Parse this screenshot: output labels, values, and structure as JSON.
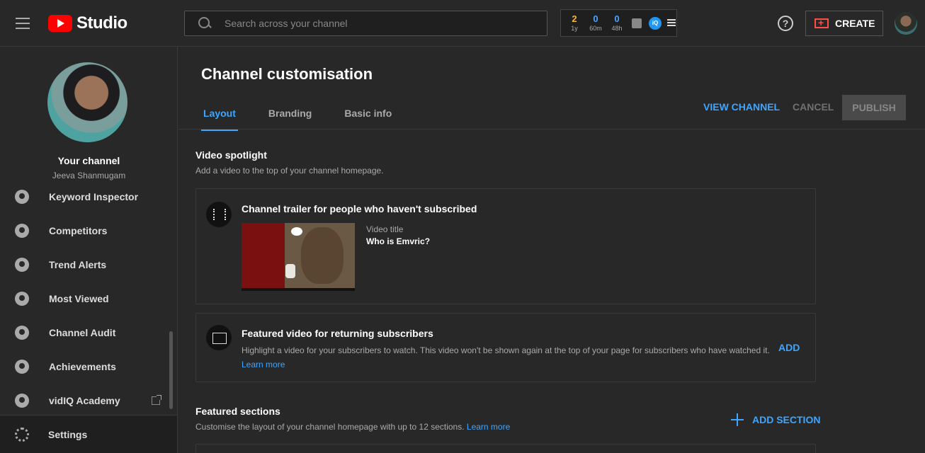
{
  "header": {
    "logo_text": "Studio",
    "search_placeholder": "Search across your channel",
    "vidiq_stats": [
      {
        "value": "2",
        "label": "1y",
        "color": "#f6b93b"
      },
      {
        "value": "0",
        "label": "60m",
        "color": "#4fa3ff"
      },
      {
        "value": "0",
        "label": "48h",
        "color": "#4fa3ff"
      }
    ],
    "vidiq_logo": "iQ",
    "help_label": "?",
    "create_label": "CREATE"
  },
  "sidebar": {
    "your_channel": "Your channel",
    "channel_name": "Jeeva Shanmugam",
    "items": [
      {
        "label": "Keyword Inspector"
      },
      {
        "label": "Competitors"
      },
      {
        "label": "Trend Alerts"
      },
      {
        "label": "Most Viewed"
      },
      {
        "label": "Channel Audit"
      },
      {
        "label": "Achievements"
      },
      {
        "label": "vidIQ Academy"
      }
    ],
    "settings_label": "Settings"
  },
  "main": {
    "title": "Channel customisation",
    "tabs": [
      {
        "label": "Layout"
      },
      {
        "label": "Branding"
      },
      {
        "label": "Basic info"
      }
    ],
    "view_channel": "VIEW CHANNEL",
    "cancel": "CANCEL",
    "publish": "PUBLISH",
    "video_spotlight": {
      "title": "Video spotlight",
      "subtitle": "Add a video to the top of your channel homepage."
    },
    "trailer_card": {
      "title": "Channel trailer for people who haven't subscribed",
      "video_title_label": "Video title",
      "video_title": "Who is Emvric?"
    },
    "featured_card": {
      "title": "Featured video for returning subscribers",
      "description": "Highlight a video for your subscribers to watch. This video won't be shown again at the top of your page for subscribers who have watched it.",
      "learn_more": "Learn more",
      "add": "ADD"
    },
    "featured_sections": {
      "title": "Featured sections",
      "subtitle": "Customise the layout of your channel homepage with up to 12 sections.",
      "learn_more": "Learn more",
      "add_section": "ADD SECTION"
    }
  }
}
